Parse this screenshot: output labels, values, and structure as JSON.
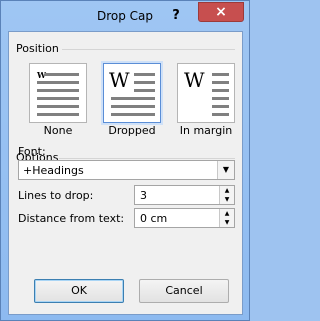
{
  "window": {
    "title": "Drop Cap",
    "help_label": "?",
    "close_label": "×"
  },
  "position": {
    "label": "Position",
    "options": [
      {
        "label": "None",
        "glyph": "W"
      },
      {
        "label": "Dropped",
        "glyph": "W"
      },
      {
        "label": "In margin",
        "glyph": "W"
      }
    ],
    "selected": "Dropped"
  },
  "options": {
    "label": "Options",
    "font": {
      "label": "Font:",
      "value": "+Headings",
      "arrow": "▼"
    },
    "lines_to_drop": {
      "label": "Lines to drop:",
      "value": "3"
    },
    "distance_from_text": {
      "label": "Distance from text:",
      "value": "0 cm"
    },
    "spin_up": "▲",
    "spin_down": "▼"
  },
  "buttons": {
    "ok": "OK",
    "cancel": "Cancel"
  },
  "colors": {
    "title_bar": "#9fc6f3",
    "close_button": "#c74f4f",
    "dialog_background": "#f0f0f0",
    "selection_border": "#5b8ed6"
  }
}
